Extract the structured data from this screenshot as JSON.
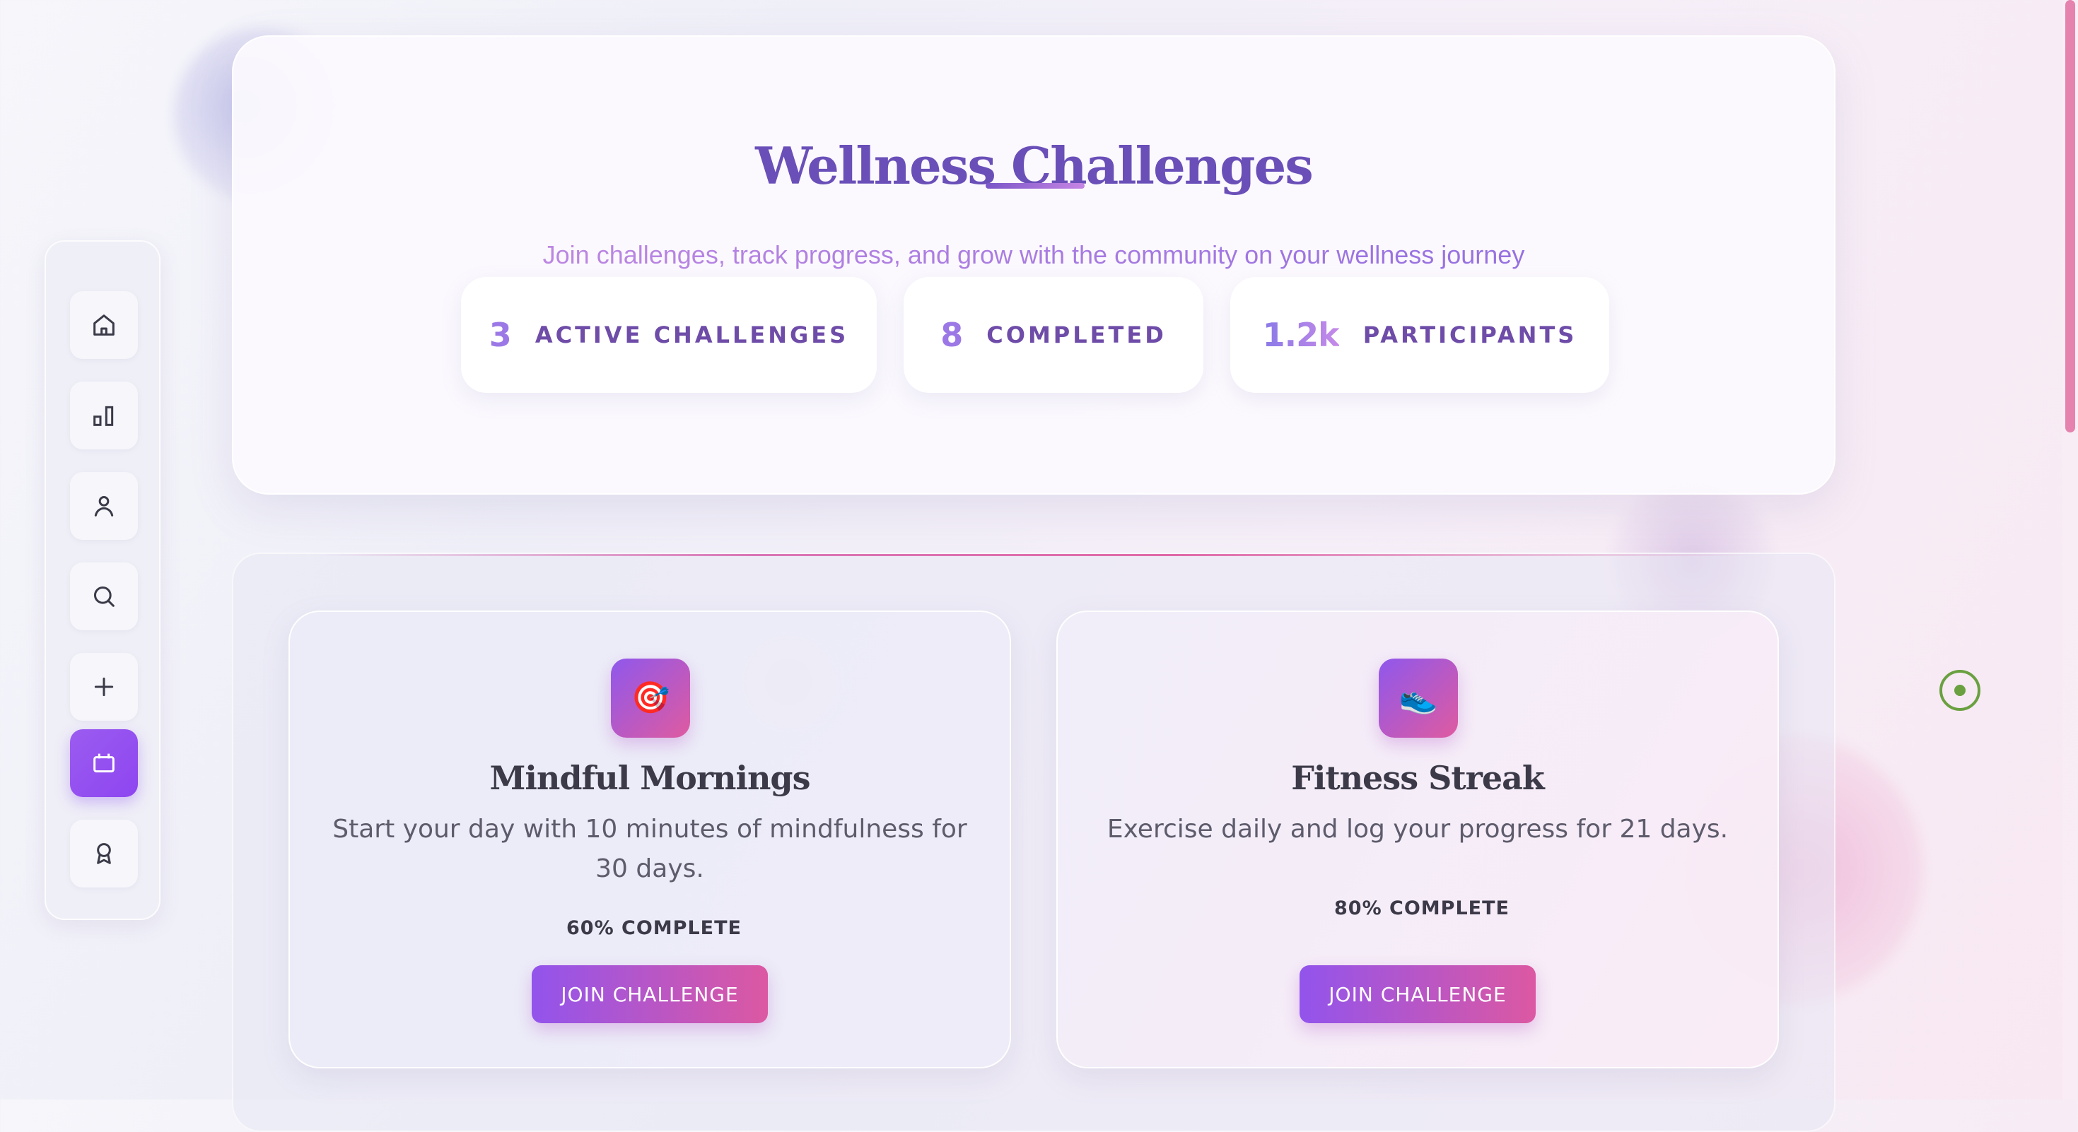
{
  "hero": {
    "title": "Wellness Challenges",
    "subtitle": "Join challenges, track progress, and grow with the community on your wellness journey"
  },
  "stats": [
    {
      "value": "3",
      "label": "ACTIVE CHALLENGES"
    },
    {
      "value": "8",
      "label": "COMPLETED"
    },
    {
      "value": "1.2k",
      "label": "PARTICIPANTS"
    }
  ],
  "sidebar": {
    "items": [
      {
        "icon": "home-icon",
        "active": false
      },
      {
        "icon": "bar-chart-icon",
        "active": false
      },
      {
        "icon": "user-icon",
        "active": false
      },
      {
        "icon": "search-icon",
        "active": false
      },
      {
        "icon": "plus-icon",
        "active": false
      },
      {
        "icon": "calendar-icon",
        "active": true
      },
      {
        "icon": "award-icon",
        "active": false
      }
    ]
  },
  "challenges": [
    {
      "icon": "target-icon",
      "emoji": "🎯",
      "title": "Mindful Mornings",
      "description": "Start your day with 10 minutes of mindfulness for 30 days.",
      "progress_percent": 60,
      "progress_text": "60% COMPLETE",
      "button_label": "JOIN CHALLENGE"
    },
    {
      "icon": "sneaker-icon",
      "emoji": "👟",
      "title": "Fitness Streak",
      "description": "Exercise daily and log your progress for 21 days.",
      "progress_percent": 80,
      "progress_text": "80% COMPLETE",
      "button_label": "JOIN CHALLENGE"
    }
  ],
  "colors": {
    "accent_purple": "#9b5cf0",
    "accent_pink": "#dc58a2",
    "title_purple": "#6a4fb8",
    "stat_label": "#6e4ca8",
    "scrollbar": "#e582ae",
    "indicator_green": "#6aa040"
  }
}
